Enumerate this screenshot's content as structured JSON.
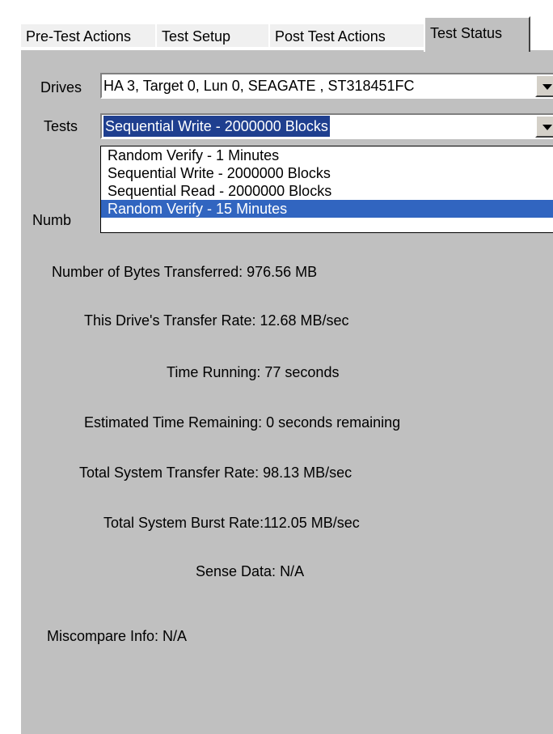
{
  "tabs": [
    {
      "label": "Pre-Test Actions"
    },
    {
      "label": "Test Setup"
    },
    {
      "label": "Post Test Actions"
    },
    {
      "label": "Test Status"
    }
  ],
  "drives": {
    "label": "Drives",
    "value": "HA 3, Target 0, Lun 0, SEAGATE , ST318451FC"
  },
  "tests": {
    "label": "Tests",
    "value": "Sequential  Write  - 2000000 Blocks",
    "options": [
      "Random  Verify  - 1 Minutes",
      "Sequential  Write  - 2000000 Blocks",
      "Sequential  Read  - 2000000 Blocks",
      "Random  Verify  - 15 Minutes"
    ],
    "highlighted_index": 3
  },
  "status": {
    "partial_label": "Numb",
    "bytes_transferred": "Number of Bytes Transferred: 976.56 MB",
    "drive_transfer_rate": "This Drive's Transfer Rate: 12.68 MB/sec",
    "time_running": "Time Running:  77 seconds",
    "estimated_remaining": "Estimated Time Remaining: 0 seconds remaining",
    "system_transfer_rate": "Total System Transfer Rate: 98.13 MB/sec",
    "system_burst_rate": "Total System Burst Rate:112.05 MB/sec",
    "sense_data": "Sense Data: N/A",
    "miscompare_info": "Miscompare Info: N/A"
  }
}
